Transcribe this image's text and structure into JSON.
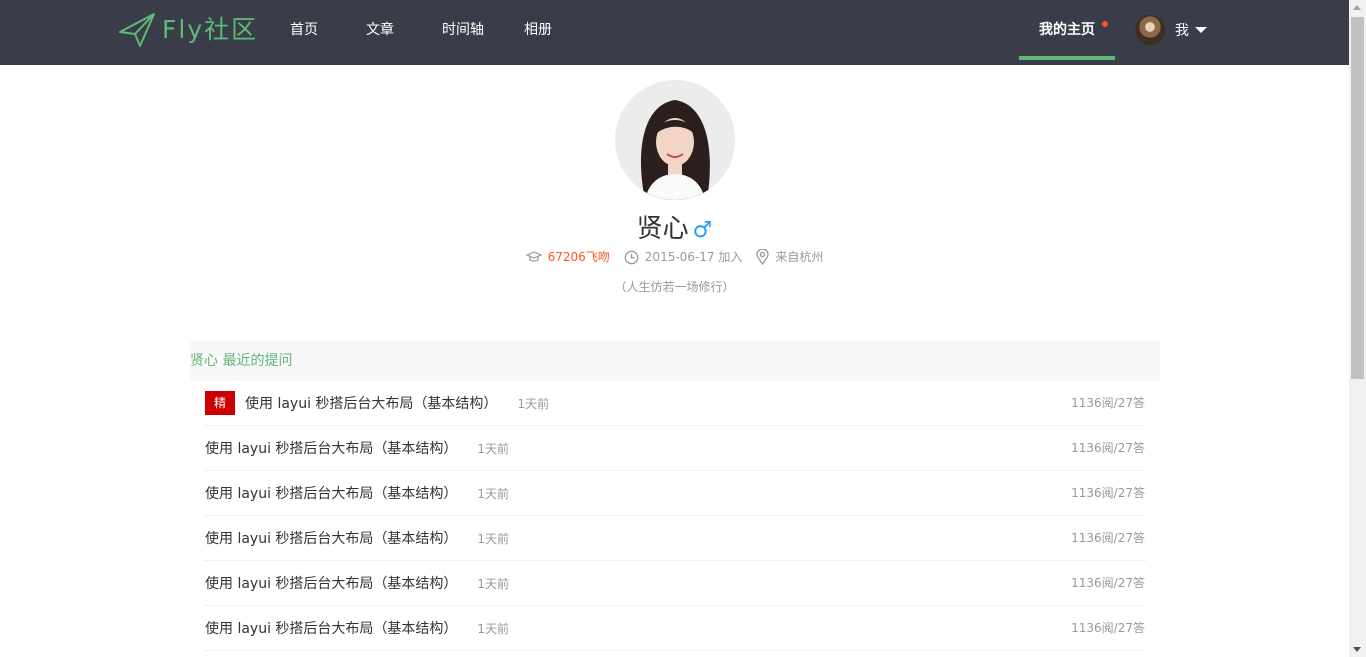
{
  "header": {
    "logo_text": "Fly社区",
    "nav": [
      "首页",
      "文章",
      "时间轴",
      "相册"
    ],
    "home_label": "我的主页",
    "user_label": "我"
  },
  "profile": {
    "name": "贤心",
    "gender_symbol": "♂",
    "kiss": "67206飞吻",
    "joined": "2015-06-17 加入",
    "location": "来自杭州",
    "sign": "（人生仿若一场修行）"
  },
  "questions": {
    "title": "贤心 最近的提问",
    "items": [
      {
        "badge": "精",
        "title": "使用 layui 秒搭后台大布局（基本结构）",
        "time": "1天前",
        "stats": "1136阅/27答"
      },
      {
        "badge": "",
        "title": "使用 layui 秒搭后台大布局（基本结构）",
        "time": "1天前",
        "stats": "1136阅/27答"
      },
      {
        "badge": "",
        "title": "使用 layui 秒搭后台大布局（基本结构）",
        "time": "1天前",
        "stats": "1136阅/27答"
      },
      {
        "badge": "",
        "title": "使用 layui 秒搭后台大布局（基本结构）",
        "time": "1天前",
        "stats": "1136阅/27答"
      },
      {
        "badge": "",
        "title": "使用 layui 秒搭后台大布局（基本结构）",
        "time": "1天前",
        "stats": "1136阅/27答"
      },
      {
        "badge": "",
        "title": "使用 layui 秒搭后台大布局（基本结构）",
        "time": "1天前",
        "stats": "1136阅/27答"
      }
    ]
  },
  "colors": {
    "header_bg": "#393d49",
    "accent_green": "#5fb878",
    "kiss_orange": "#ff5722",
    "badge_red": "#cc0000",
    "gender_blue": "#1e9fff"
  },
  "icons": [
    "paper-plane-icon",
    "notification-dot-icon",
    "caret-down-icon",
    "graduation-cap-icon",
    "clock-icon",
    "location-pin-icon",
    "male-icon"
  ]
}
